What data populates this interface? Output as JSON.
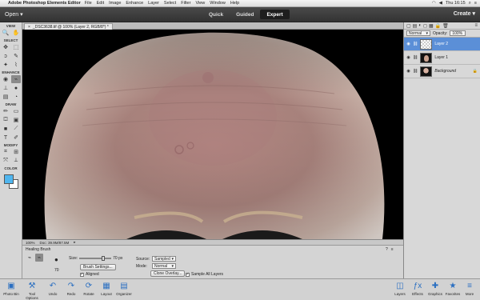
{
  "menubar": {
    "app_name": "Adobe Photoshop Elements Editor",
    "items": [
      "File",
      "Edit",
      "Image",
      "Enhance",
      "Layer",
      "Select",
      "Filter",
      "View",
      "Window",
      "Help"
    ],
    "clock": "Thu 16:15"
  },
  "appbar": {
    "open_label": "Open",
    "modes": [
      "Quick",
      "Guided",
      "Expert"
    ],
    "active_mode": "Expert",
    "create_label": "Create"
  },
  "toolpanel": {
    "sections": [
      "VIEW",
      "SELECT",
      "ENHANCE",
      "DRAW",
      "MODIFY",
      "COLOR"
    ]
  },
  "document": {
    "tab_title": "_DSC3638.tif @ 100% (Layer 2, RGB/8*) *"
  },
  "statusbar": {
    "zoom": "100%",
    "doc_info": "Doc: 39.9M/87.5M"
  },
  "tooloptions": {
    "tool_name": "Healing Brush",
    "brush_size_label": "70",
    "size_label": "Size:",
    "size_value": "70 px",
    "brush_settings_label": "Brush Settings...",
    "aligned_label": "Aligned",
    "source_label": "Source:",
    "source_value": "Sampled",
    "mode_label": "Mode:",
    "mode_value": "Normal",
    "clone_overlay_label": "Clone Overlay...",
    "sample_all_layers_label": "Sample All Layers"
  },
  "layers": {
    "blend_mode": "Normal",
    "opacity_label": "Opacity:",
    "opacity_value": "100%",
    "items": [
      {
        "name": "Layer 2"
      },
      {
        "name": "Layer 1"
      },
      {
        "name": "Background"
      }
    ]
  },
  "taskbar": {
    "left": [
      "Photo Bin",
      "Tool Options",
      "Undo",
      "Redo",
      "Rotate",
      "Layout",
      "Organizer"
    ],
    "right": [
      "Layers",
      "Effects",
      "Graphics",
      "Favorites",
      "More"
    ]
  }
}
